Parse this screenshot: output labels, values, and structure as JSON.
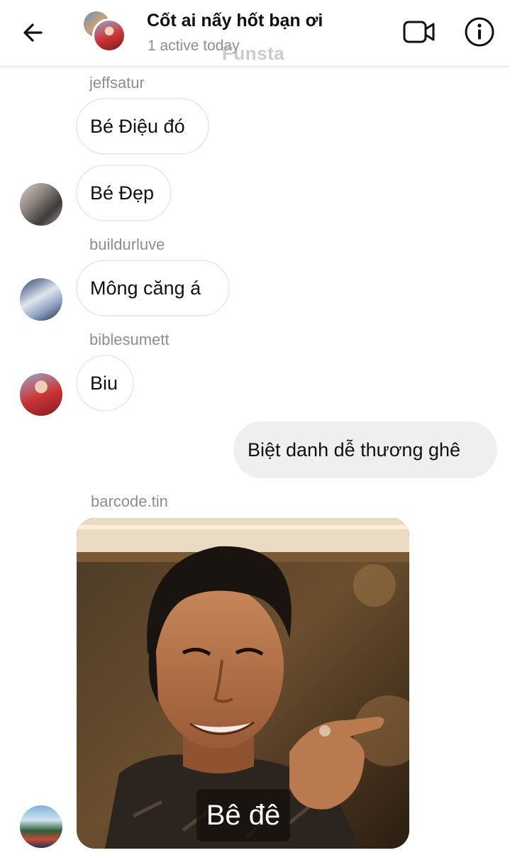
{
  "header": {
    "title": "Cốt ai nấy hốt bạn ơi",
    "subtitle": "1 active today",
    "watermark": "Funsta"
  },
  "messages": [
    {
      "username": "jeffsatur",
      "text": "Bé Điệu đó"
    },
    {
      "text": "Bé Đẹp"
    },
    {
      "username": "buildurluve",
      "text": "Mông căng á"
    },
    {
      "username": "biblesumett",
      "text": "Biu"
    },
    {
      "text": "Biệt danh dễ thương ghê"
    },
    {
      "username": "barcode.tin",
      "image_caption": "Bê đê"
    }
  ],
  "colors": {
    "incoming_border": "#ececec",
    "outgoing_bg": "#efefef",
    "username_gray": "#8e8e8e"
  },
  "icons": [
    "back-arrow-icon",
    "video-camera-icon",
    "info-icon"
  ]
}
